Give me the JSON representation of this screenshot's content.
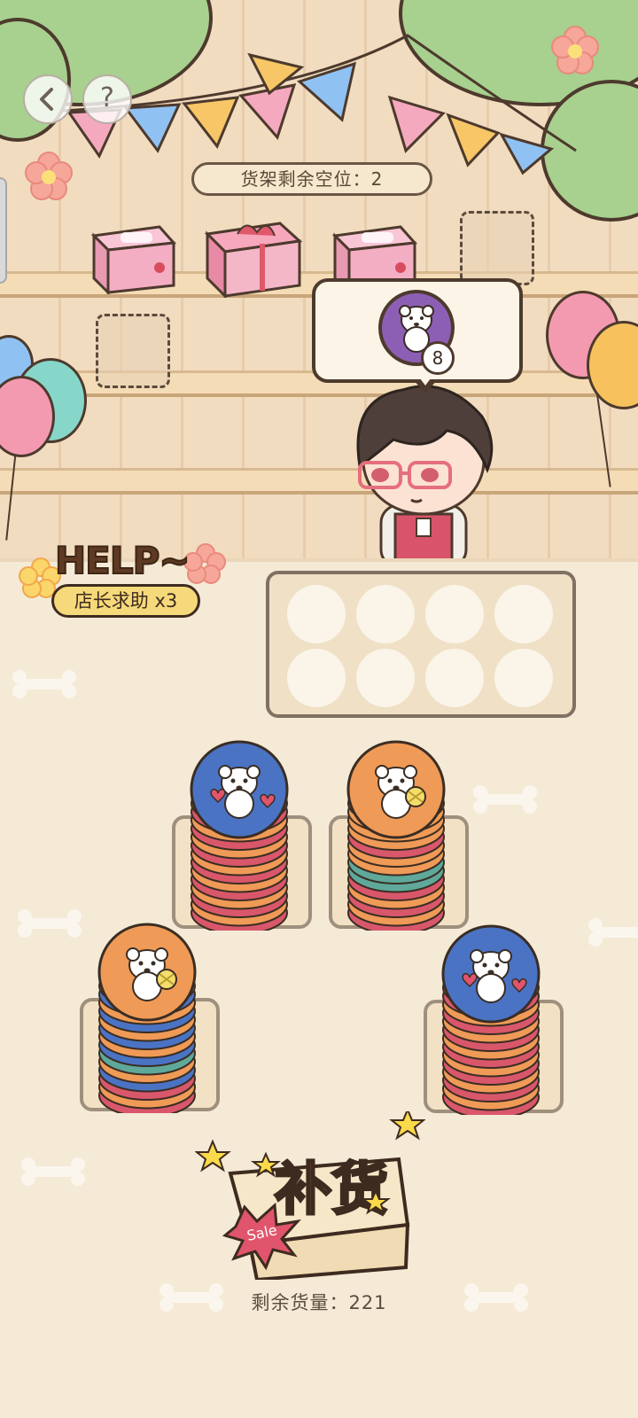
{
  "top_bar": {
    "back_icon": "chevron-left-icon",
    "help_label": "?"
  },
  "shelf": {
    "remaining_slots_label": "货架剩余空位：2",
    "items": [
      "gift-box",
      "gift-box",
      "gift-box"
    ],
    "empty_slots": 2
  },
  "order": {
    "token_color": "#8d5fb4",
    "token_icon": "white-dog-icon",
    "count": "8"
  },
  "help": {
    "title": "HELP~",
    "label": "店长求助 x3"
  },
  "tray": {
    "slots": 8,
    "filled": 0
  },
  "stacks": [
    {
      "top_color": "#4a73c4",
      "top_icon": "white-dog-hearts-icon",
      "layers": 14
    },
    {
      "top_color": "#ef9a56",
      "top_icon": "white-dog-bouquet-icon",
      "layers": 14
    },
    {
      "top_color": "#ef9a56",
      "top_icon": "white-dog-bouquet-icon",
      "layers": 14
    },
    {
      "top_color": "#4a73c4",
      "top_icon": "white-dog-hearts-icon",
      "layers": 14
    }
  ],
  "restock": {
    "label": "补货",
    "sale_tag": "Sale",
    "remaining_label": "剩余货量：221"
  },
  "colors": {
    "blue": "#4a73c4",
    "orange": "#ef9a56",
    "red": "#d9576a",
    "teal": "#5fa89a",
    "purple": "#8d5fb4"
  }
}
